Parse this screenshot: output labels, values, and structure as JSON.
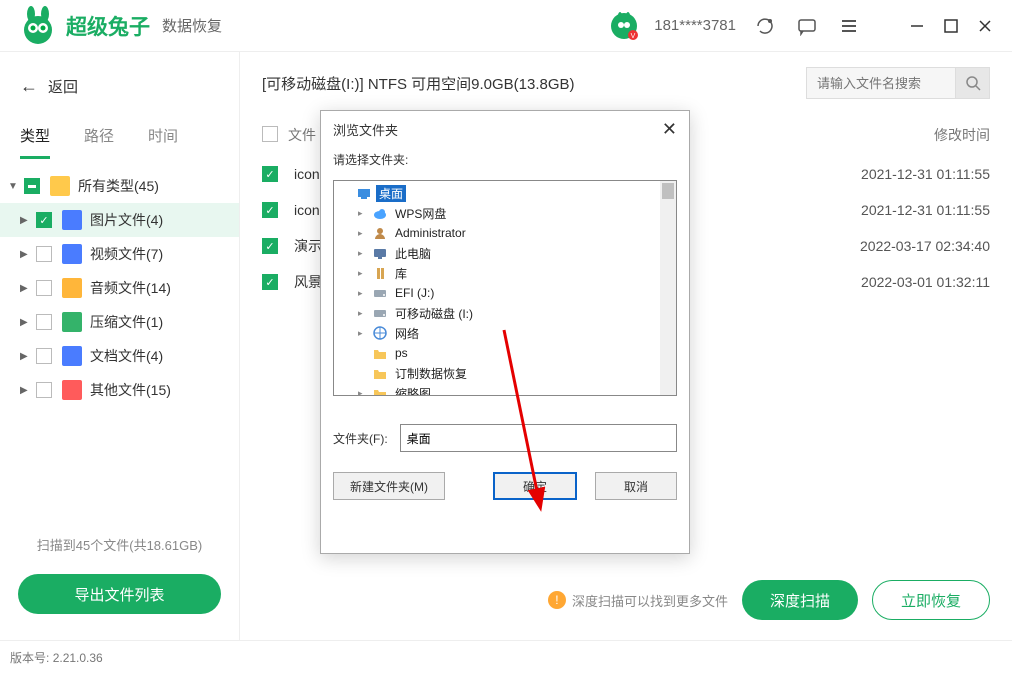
{
  "header": {
    "app_name": "超级兔子",
    "app_sub": "数据恢复",
    "user_id": "181****3781"
  },
  "sidebar": {
    "back": "返回",
    "tabs": {
      "type": "类型",
      "path": "路径",
      "time": "时间"
    },
    "items": {
      "all": {
        "label": "所有类型(45)"
      },
      "img": {
        "label": "图片文件(4)"
      },
      "vid": {
        "label": "视频文件(7)"
      },
      "aud": {
        "label": "音频文件(14)"
      },
      "zip": {
        "label": "压缩文件(1)"
      },
      "doc": {
        "label": "文档文件(4)"
      },
      "other": {
        "label": "其他文件(15)"
      }
    },
    "scan_info": "扫描到45个文件(共18.61GB)",
    "export": "导出文件列表"
  },
  "main": {
    "title": "[可移动磁盘(I:)] NTFS 可用空间9.0GB(13.8GB)",
    "search_placeholder": "请输入文件名搜索",
    "cols": {
      "name": "文件",
      "date": "修改时间"
    },
    "rows": [
      {
        "name": "icon",
        "date": "2021-12-31 01:11:55"
      },
      {
        "name": "icon",
        "date": "2021-12-31 01:11:55"
      },
      {
        "name": "演示",
        "date": "2022-03-17 02:34:40"
      },
      {
        "name": "风景",
        "date": "2022-03-01 01:32:11"
      }
    ],
    "hint": "深度扫描可以找到更多文件",
    "deep_btn": "深度扫描",
    "recover_btn": "立即恢复"
  },
  "dialog": {
    "title": "浏览文件夹",
    "prompt": "请选择文件夹:",
    "tree": [
      {
        "label": "桌面",
        "depth": 0,
        "icon": "desktop",
        "sel": true
      },
      {
        "label": "WPS网盘",
        "depth": 1,
        "icon": "cloud",
        "caret": true
      },
      {
        "label": "Administrator",
        "depth": 1,
        "icon": "user",
        "caret": true
      },
      {
        "label": "此电脑",
        "depth": 1,
        "icon": "pc",
        "caret": true
      },
      {
        "label": "库",
        "depth": 1,
        "icon": "lib",
        "caret": true
      },
      {
        "label": "EFI (J:)",
        "depth": 1,
        "icon": "drive",
        "caret": true
      },
      {
        "label": "可移动磁盘 (I:)",
        "depth": 1,
        "icon": "drive",
        "caret": true
      },
      {
        "label": "网络",
        "depth": 1,
        "icon": "net",
        "caret": true
      },
      {
        "label": "ps",
        "depth": 1,
        "icon": "folder"
      },
      {
        "label": "订制数据恢复",
        "depth": 1,
        "icon": "folder"
      },
      {
        "label": "缩略图",
        "depth": 1,
        "icon": "folder",
        "caret": true
      }
    ],
    "field_label": "文件夹(F):",
    "field_value": "桌面",
    "btn_new": "新建文件夹(M)",
    "btn_ok": "确定",
    "btn_cancel": "取消"
  },
  "footer": {
    "version_label": "版本号:",
    "version": "2.21.0.36"
  }
}
